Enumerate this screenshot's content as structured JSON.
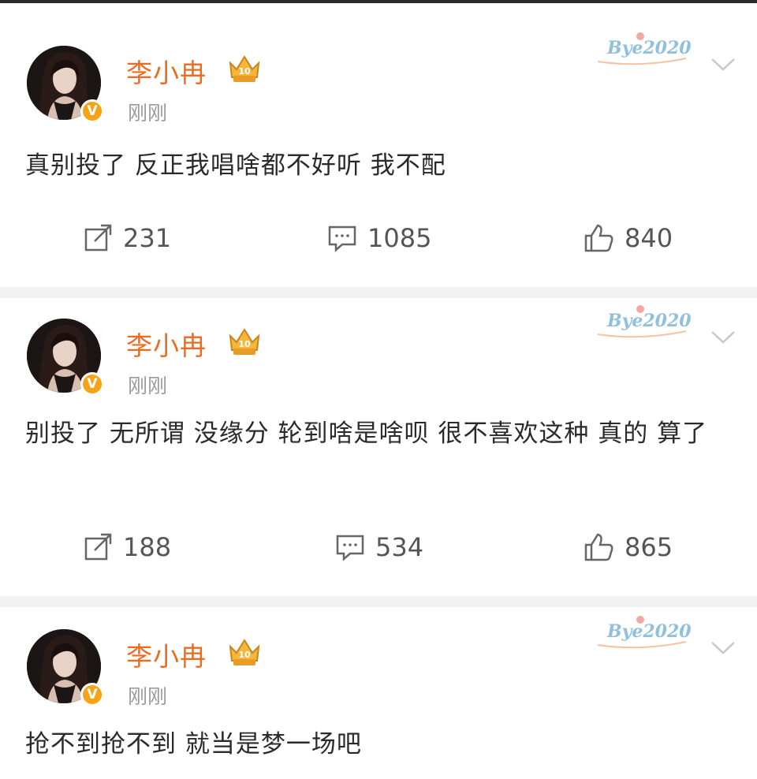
{
  "posts": [
    {
      "author": "李小冉",
      "time": "刚刚",
      "text": "真别投了 反正我唱啥都不好听 我不配",
      "reposts": "231",
      "comments": "1085",
      "likes": "840"
    },
    {
      "author": "李小冉",
      "time": "刚刚",
      "text": "别投了 无所谓 没缘分 轮到啥是啥呗 很不喜欢这种 真的 算了",
      "reposts": "188",
      "comments": "534",
      "likes": "865"
    },
    {
      "author": "李小冉",
      "time": "刚刚",
      "text": "抢不到抢不到 就当是梦一场吧"
    }
  ],
  "decoration_text": "Bye2020",
  "badge_glyph": "V",
  "colors": {
    "username": "#f06a1d",
    "verified_badge": "#f7a318",
    "timestamp": "#9a9a9a",
    "separator": "#f2f2f2"
  },
  "icons": [
    "repost-icon",
    "comment-icon",
    "like-icon",
    "chevron-down-icon",
    "vip-crown-icon",
    "verified-badge-icon"
  ]
}
